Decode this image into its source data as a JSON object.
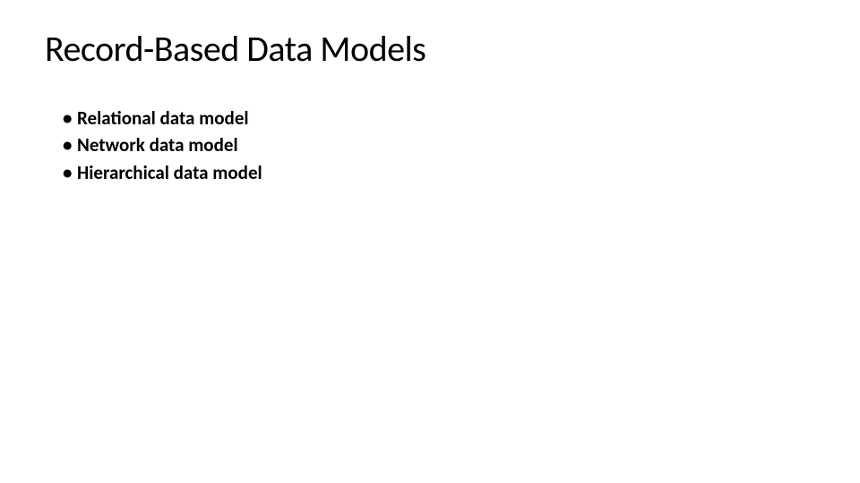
{
  "slide": {
    "title": "Record-Based Data Models",
    "bullets": [
      "Relational data model",
      "Network data model",
      "Hierarchical data model"
    ]
  }
}
